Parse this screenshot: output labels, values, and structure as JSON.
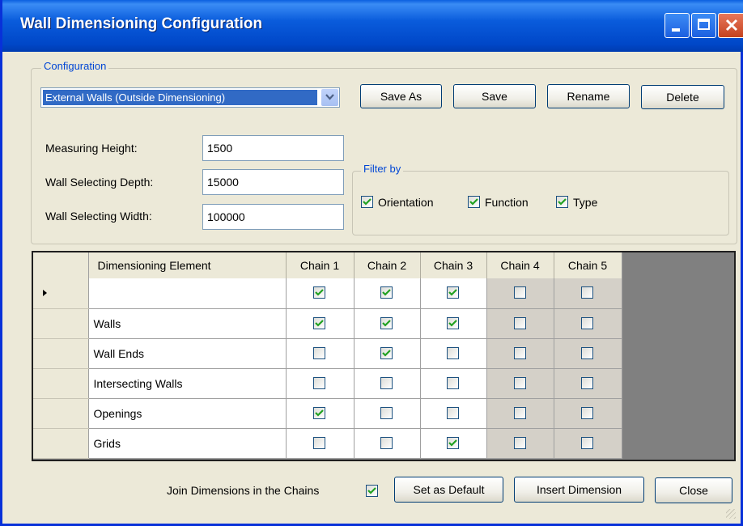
{
  "window": {
    "title": "Wall Dimensioning Configuration"
  },
  "configuration": {
    "legend": "Configuration",
    "selected": "External Walls (Outside Dimensioning)",
    "buttons": {
      "save_as": "Save As",
      "save": "Save",
      "rename": "Rename",
      "delete": "Delete"
    }
  },
  "fields": {
    "measuring_height": {
      "label": "Measuring Height:",
      "value": "1500"
    },
    "wall_selecting_depth": {
      "label": "Wall Selecting Depth:",
      "value": "15000"
    },
    "wall_selecting_width": {
      "label": "Wall Selecting Width:",
      "value": "100000"
    }
  },
  "filter": {
    "legend": "Filter by",
    "orientation": {
      "label": "Orientation",
      "checked": true
    },
    "function": {
      "label": "Function",
      "checked": true
    },
    "type": {
      "label": "Type",
      "checked": true
    }
  },
  "grid": {
    "headers": [
      "Dimensioning Element",
      "Chain 1",
      "Chain 2",
      "Chain 3",
      "Chain 4",
      "Chain 5"
    ],
    "rows": [
      {
        "label": "",
        "checks": [
          true,
          true,
          true,
          false,
          false
        ],
        "current": true
      },
      {
        "label": "Walls",
        "checks": [
          true,
          true,
          true,
          false,
          false
        ]
      },
      {
        "label": "Wall Ends",
        "checks": [
          false,
          true,
          false,
          false,
          false
        ]
      },
      {
        "label": "Intersecting Walls",
        "checks": [
          false,
          false,
          false,
          false,
          false
        ]
      },
      {
        "label": "Openings",
        "checks": [
          true,
          false,
          false,
          false,
          false
        ]
      },
      {
        "label": "Grids",
        "checks": [
          false,
          false,
          true,
          false,
          false
        ]
      }
    ]
  },
  "footer": {
    "join_label": "Join Dimensions in the Chains",
    "join_checked": true,
    "set_default": "Set as Default",
    "insert_dimension": "Insert Dimension",
    "close": "Close"
  },
  "colors": {
    "title_bar": "#0a5cdc",
    "face": "#ece9d8",
    "legend": "#0046d5",
    "selection": "#316ac5"
  }
}
